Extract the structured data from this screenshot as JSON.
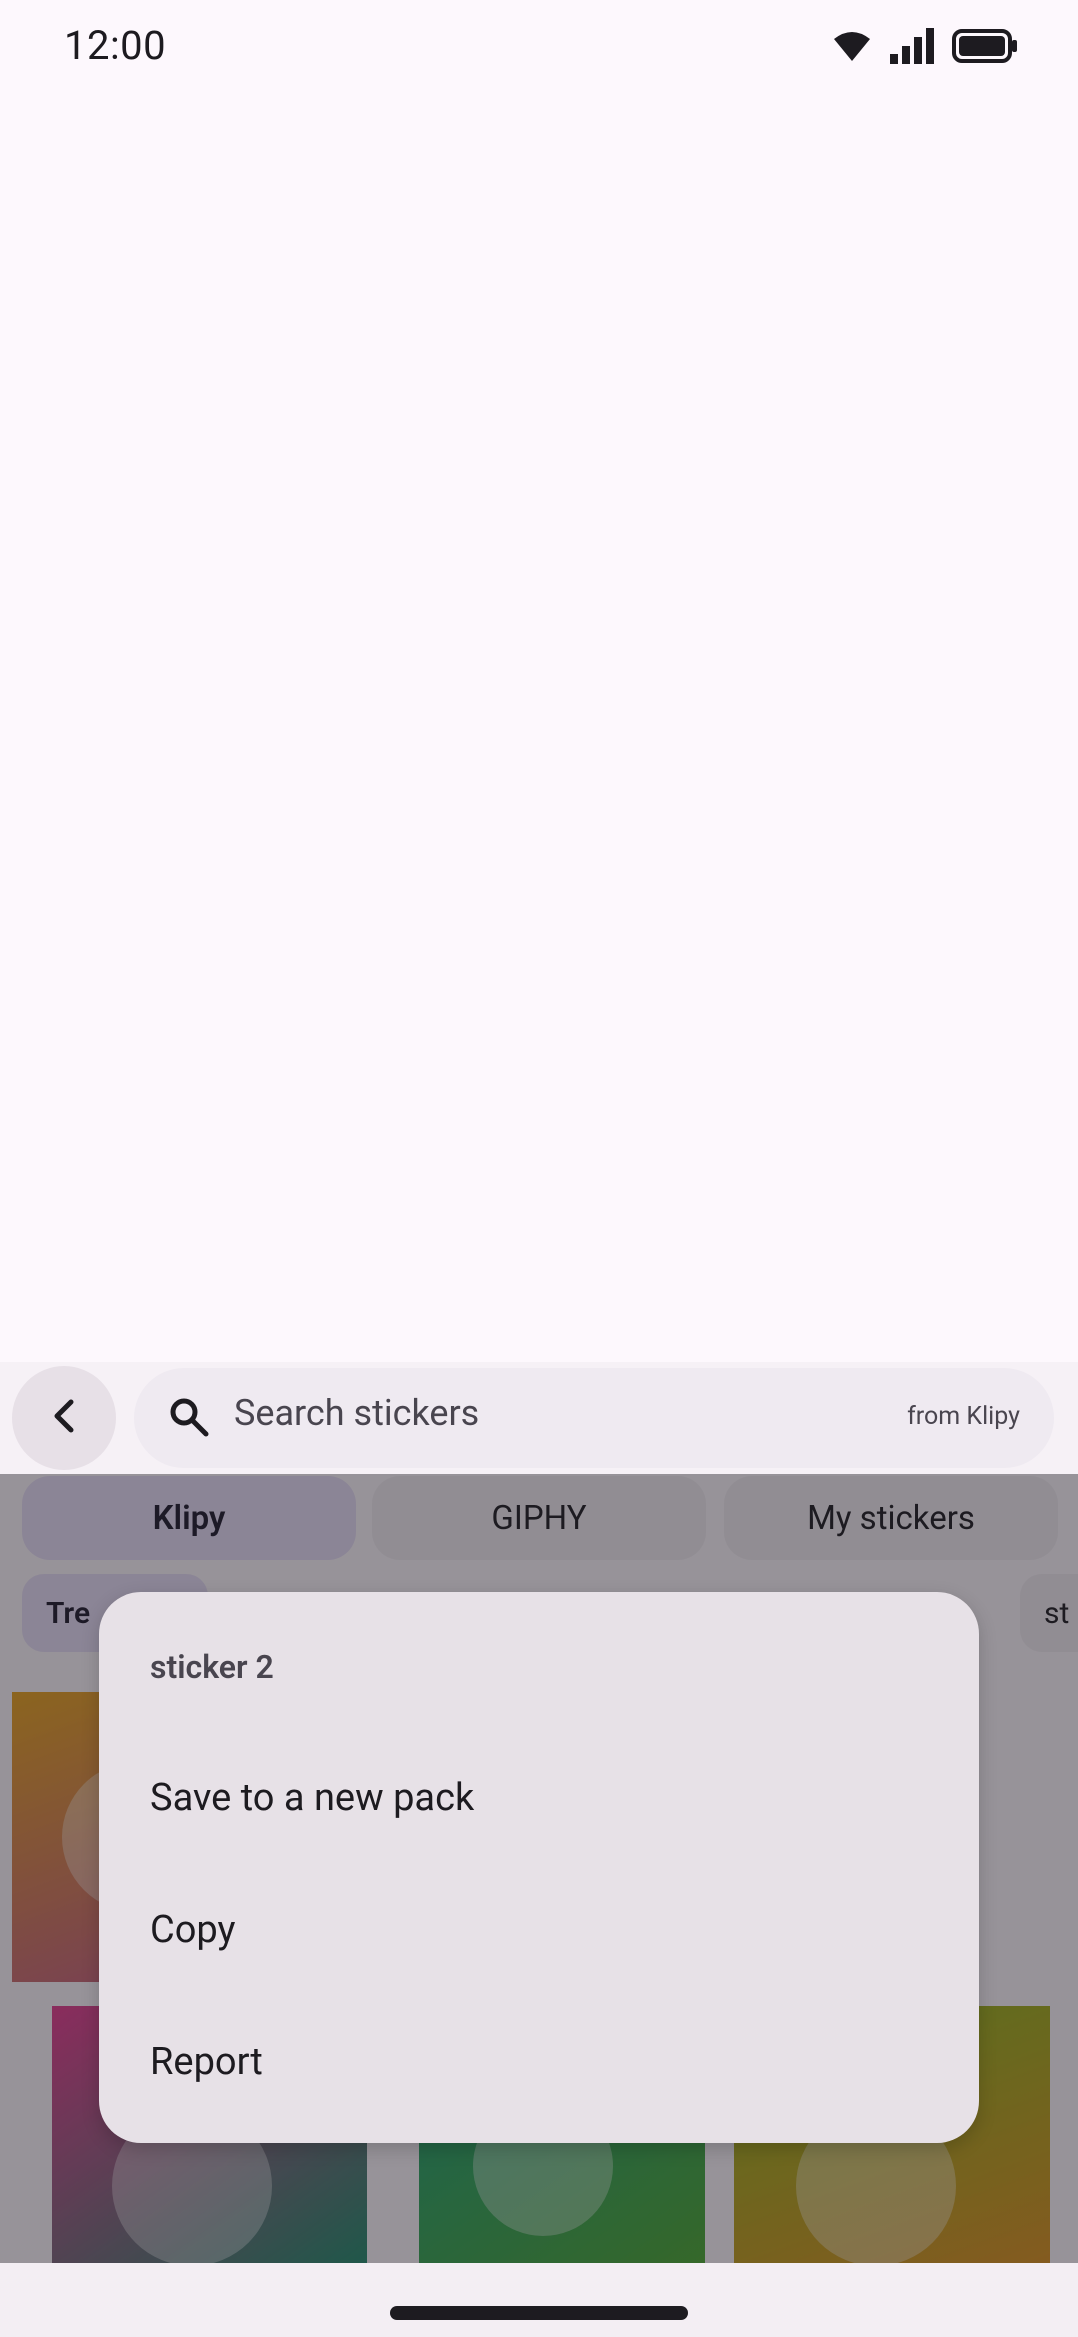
{
  "status_bar": {
    "time": "12:00",
    "icons": [
      "wifi-icon",
      "signal-icon",
      "battery-icon"
    ]
  },
  "search": {
    "back_icon": "chevron-left-icon",
    "search_icon": "search-icon",
    "placeholder": "Search stickers",
    "source_label": "from Klipy"
  },
  "tabs": [
    {
      "label": "Klipy",
      "active": true
    },
    {
      "label": "GIPHY",
      "active": false
    },
    {
      "label": "My stickers",
      "active": false
    }
  ],
  "chips": [
    {
      "label": "Tre",
      "active": true
    },
    {
      "label": "st",
      "active": false
    }
  ],
  "menu": {
    "title": "sticker 2",
    "items": [
      {
        "label": "Save to a new pack"
      },
      {
        "label": "Copy"
      },
      {
        "label": "Report"
      }
    ]
  },
  "colors": {
    "background": "#fdf8fd",
    "accent_container": "#e8def8",
    "menu_surface": "#e7e1e7",
    "scrim": "rgba(30,28,34,0.46)"
  }
}
